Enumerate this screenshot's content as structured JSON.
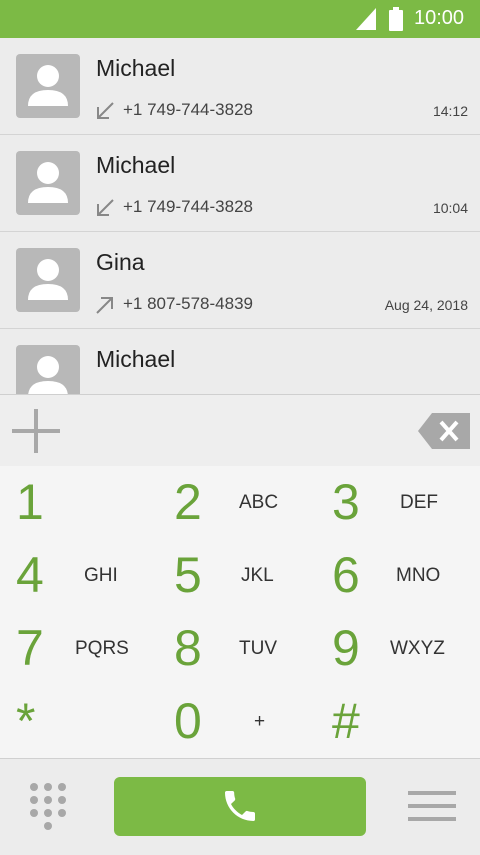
{
  "status_bar": {
    "time": "10:00",
    "icons": [
      "signal-icon",
      "battery-icon"
    ],
    "color": "#7cba45"
  },
  "call_log": [
    {
      "name": "Michael",
      "number": "+1 749-744-3828",
      "time": "14:12",
      "direction": "incoming"
    },
    {
      "name": "Michael",
      "number": "+1 749-744-3828",
      "time": "10:04",
      "direction": "incoming"
    },
    {
      "name": "Gina",
      "number": "+1 807-578-4839",
      "time": "Aug 24, 2018",
      "direction": "outgoing"
    },
    {
      "name": "Michael",
      "number": "",
      "time": "",
      "direction": ""
    }
  ],
  "keypad": {
    "accent_color": "#6aa33a",
    "keys": [
      {
        "digit": "1",
        "letters": ""
      },
      {
        "digit": "2",
        "letters": "ABC"
      },
      {
        "digit": "3",
        "letters": "DEF"
      },
      {
        "digit": "4",
        "letters": "GHI"
      },
      {
        "digit": "5",
        "letters": "JKL"
      },
      {
        "digit": "6",
        "letters": "MNO"
      },
      {
        "digit": "7",
        "letters": "PQRS"
      },
      {
        "digit": "8",
        "letters": "TUV"
      },
      {
        "digit": "9",
        "letters": "WXYZ"
      },
      {
        "digit": "*",
        "letters": ""
      },
      {
        "digit": "0",
        "letters": "+"
      },
      {
        "digit": "#",
        "letters": ""
      }
    ]
  },
  "input": {
    "icons": [
      "plus-icon",
      "backspace-icon"
    ]
  },
  "bottom_bar": {
    "icons": [
      "dialpad-icon",
      "phone-icon",
      "menu-icon"
    ],
    "call_button_color": "#7cba45"
  }
}
